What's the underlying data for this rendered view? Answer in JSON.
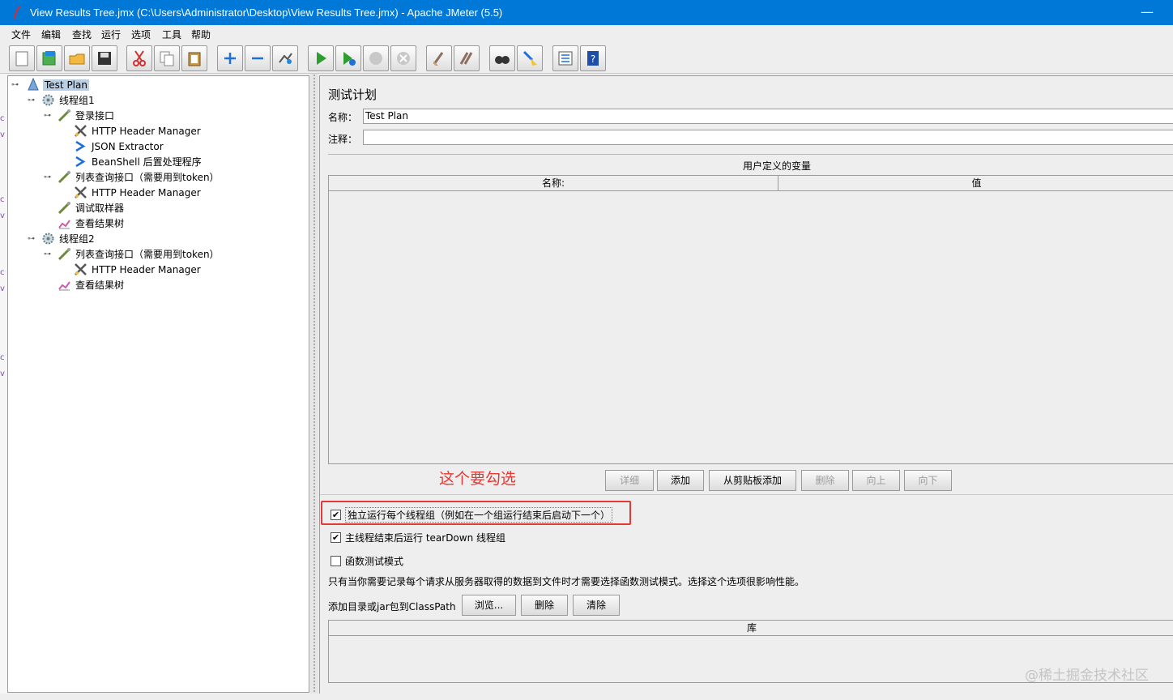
{
  "window": {
    "title": "View Results Tree.jmx (C:\\Users\\Administrator\\Desktop\\View Results Tree.jmx) - Apache JMeter (5.5)",
    "minimize_glyph": "—"
  },
  "menu": [
    "文件",
    "编辑",
    "查找",
    "运行",
    "选项",
    "工具",
    "帮助"
  ],
  "toolbar_icons": [
    "new-icon",
    "templates-icon",
    "open-icon",
    "save-icon",
    "cut-icon",
    "copy-icon",
    "paste-icon",
    "expand-icon",
    "collapse-icon",
    "toggle-icon",
    "start-icon",
    "start-no-pause-icon",
    "stop-icon",
    "shutdown-icon",
    "clear-icon",
    "clear-all-icon",
    "search-icon",
    "reset-search-icon",
    "function-helper-icon",
    "help-icon"
  ],
  "tree": [
    {
      "label": "Test Plan",
      "icon": "test-plan-icon",
      "selected": true
    },
    {
      "label": "线程组1",
      "icon": "thread-group-icon"
    },
    {
      "label": "登录接口",
      "icon": "sampler-icon"
    },
    {
      "label": "HTTP Header Manager",
      "icon": "config-icon"
    },
    {
      "label": "JSON Extractor",
      "icon": "postprocessor-icon"
    },
    {
      "label": "BeanShell 后置处理程序",
      "icon": "postprocessor-icon"
    },
    {
      "label": "列表查询接口（需要用到token）",
      "icon": "sampler-icon"
    },
    {
      "label": "HTTP Header Manager",
      "icon": "config-icon"
    },
    {
      "label": "调试取样器",
      "icon": "sampler-icon"
    },
    {
      "label": "查看结果树",
      "icon": "listener-icon"
    },
    {
      "label": "线程组2",
      "icon": "thread-group-icon"
    },
    {
      "label": "列表查询接口（需要用到token）",
      "icon": "sampler-icon"
    },
    {
      "label": "HTTP Header Manager",
      "icon": "config-icon"
    },
    {
      "label": "查看结果树",
      "icon": "listener-icon"
    }
  ],
  "panel": {
    "title": "测试计划",
    "name_label": "名称：",
    "name_value": "Test Plan",
    "comment_label": "注释：",
    "comment_value": "",
    "variables_title": "用户定义的变量",
    "variables_columns": [
      "名称:",
      "值"
    ],
    "variables_buttons": [
      {
        "label": "详细",
        "enabled": false
      },
      {
        "label": "添加",
        "enabled": true
      },
      {
        "label": "从剪贴板添加",
        "enabled": true
      },
      {
        "label": "删除",
        "enabled": false
      },
      {
        "label": "向上",
        "enabled": false
      },
      {
        "label": "向下",
        "enabled": false
      }
    ],
    "annotation": "这个要勾选",
    "options": [
      {
        "label": "独立运行每个线程组（例如在一个组运行结束后启动下一个）",
        "checked": true,
        "checkmark": "✔"
      },
      {
        "label": "主线程结束后运行 tearDown 线程组",
        "checked": true,
        "checkmark": "✔"
      },
      {
        "label": "函数测试模式",
        "checked": false,
        "checkmark": ""
      }
    ],
    "functional_note": "只有当你需要记录每个请求从服务器取得的数据到文件时才需要选择函数测试模式。选择这个选项很影响性能。",
    "classpath_label": "添加目录或jar包到ClassPath",
    "classpath_buttons": [
      "浏览...",
      "删除",
      "清除"
    ],
    "library_column": "库"
  },
  "watermark": "@稀土掘金技术社区"
}
